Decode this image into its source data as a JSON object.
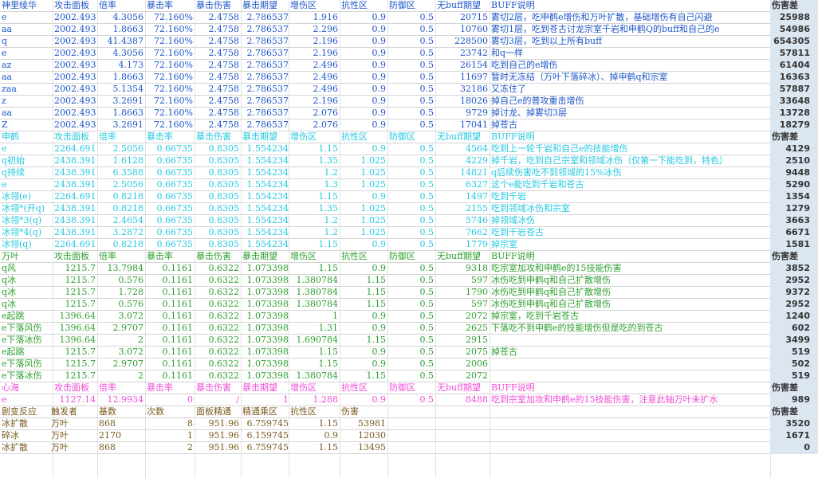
{
  "colors": {
    "ayaka": "#1e56c8",
    "shenhe": "#26c8e0",
    "kazuha": "#2e9e2e",
    "kokomi": "#f04cd6",
    "reaction": "#7a5a1e",
    "damage_bg": "#dce6f1"
  },
  "ayaka": {
    "header": [
      "神里绫华",
      "攻击面板",
      "倍率",
      "暴击率",
      "暴击伤害",
      "暴击期望",
      "增伤区",
      "抗性区",
      "防御区",
      "无buff期望",
      "BUFF说明",
      "伤害差"
    ],
    "rows": [
      [
        "e",
        "2002.493",
        "4.3056",
        "72.160%",
        "2.4758",
        "2.786537",
        "1.916",
        "0.9",
        "0.5",
        "20715",
        "雾切2层，吃申鹤e增伤和万叶扩散，基础增伤有自己闪避",
        "25988"
      ],
      [
        "aa",
        "2002.493",
        "1.8663",
        "72.160%",
        "2.4758",
        "2.786537",
        "2.296",
        "0.9",
        "0.5",
        "10760",
        "雾切1层，吃到苍古讨龙宗室千岩和申鹤Q的buff和自己的e",
        "54986"
      ],
      [
        "q",
        "2002.493",
        "41.4387",
        "72.160%",
        "2.4758",
        "2.786537",
        "2.196",
        "0.9",
        "0.5",
        "228500",
        "雾切3层，吃到以上所有buff",
        "654305"
      ],
      [
        "e",
        "2002.493",
        "4.3056",
        "72.160%",
        "2.4758",
        "2.786537",
        "2.196",
        "0.9",
        "0.5",
        "23742",
        "和q一样",
        "57811"
      ],
      [
        "az",
        "2002.493",
        "4.173",
        "72.160%",
        "2.4758",
        "2.786537",
        "2.496",
        "0.9",
        "0.5",
        "26154",
        "吃到自己的e增伤",
        "61404"
      ],
      [
        "aa",
        "2002.493",
        "1.8663",
        "72.160%",
        "2.4758",
        "2.786537",
        "2.496",
        "0.9",
        "0.5",
        "11697",
        "暂时无冻结（万叶下落碎冰）、掉申鹤q和宗室",
        "16363"
      ],
      [
        "zaa",
        "2002.493",
        "5.1354",
        "72.160%",
        "2.4758",
        "2.786537",
        "2.496",
        "0.9",
        "0.5",
        "32186",
        "又冻住了",
        "57887"
      ],
      [
        "z",
        "2002.493",
        "3.2691",
        "72.160%",
        "2.4758",
        "2.786537",
        "2.196",
        "0.9",
        "0.5",
        "18026",
        "掉自己e的普攻重击增伤",
        "33648"
      ],
      [
        "aa",
        "2002.493",
        "1.8663",
        "72.160%",
        "2.4758",
        "2.786537",
        "2.076",
        "0.9",
        "0.5",
        "9729",
        "掉讨龙、掉雾切3层",
        "13728"
      ],
      [
        "Z",
        "2002.493",
        "3.2691",
        "72.160%",
        "2.4758",
        "2.786537",
        "2.076",
        "0.9",
        "0.5",
        "17041",
        "掉苍古",
        "18279"
      ]
    ]
  },
  "shenhe": {
    "header": [
      "申鹤",
      "攻击面板",
      "倍率",
      "暴击率",
      "暴击伤害",
      "暴击期望",
      "增伤区",
      "抗性区",
      "防御区",
      "无buff期望",
      "BUFF说明",
      "伤害差"
    ],
    "rows": [
      [
        "e",
        "2264.691",
        "2.5056",
        "0.66735",
        "0.8305",
        "1.554234",
        "1.15",
        "0.9",
        "0.5",
        "4564",
        "吃到上一轮千岩和自己e的技能增伤",
        "4129"
      ],
      [
        "q初始",
        "2438.391",
        "1.6128",
        "0.66735",
        "0.8305",
        "1.554234",
        "1.35",
        "1.025",
        "0.5",
        "4229",
        "掉千岩，吃到自己宗室和领域冰伤（仅第一下能吃到，特色）",
        "2510"
      ],
      [
        "q持续",
        "2438.391",
        "6.3588",
        "0.66735",
        "0.8305",
        "1.554234",
        "1.2",
        "1.025",
        "0.5",
        "14821",
        "q后续伤害吃不到领域的15%冰伤",
        "9448"
      ],
      [
        "e",
        "2438.391",
        "2.5056",
        "0.66735",
        "0.8305",
        "1.554234",
        "1.3",
        "1.025",
        "0.5",
        "6327",
        "这个e能吃到千岩和苍古",
        "5290"
      ],
      [
        "冰翎(e)",
        "2264.691",
        "0.8218",
        "0.66735",
        "0.8305",
        "1.554234",
        "1.15",
        "0.9",
        "0.5",
        "1497",
        "吃到千岩",
        "1354"
      ],
      [
        "冰翎*(开q)",
        "2438.391",
        "0.8218",
        "0.66735",
        "0.8305",
        "1.554234",
        "1.35",
        "1.025",
        "0.5",
        "2155",
        "吃到领域冰伤和宗室",
        "1279"
      ],
      [
        "冰翎*3(q)",
        "2438.391",
        "2.4654",
        "0.66735",
        "0.8305",
        "1.554234",
        "1.2",
        "1.025",
        "0.5",
        "5746",
        "掉领域冰伤",
        "3663"
      ],
      [
        "冰翎*4(q)",
        "2438.391",
        "3.2872",
        "0.66735",
        "0.8305",
        "1.554234",
        "1.2",
        "1.025",
        "0.5",
        "7662",
        "吃到千岩苍古",
        "6671"
      ],
      [
        "冰翎(q)",
        "2264.691",
        "0.8218",
        "0.66735",
        "0.8305",
        "1.554234",
        "1.15",
        "0.9",
        "0.5",
        "1779",
        "掉宗室",
        "1581"
      ]
    ]
  },
  "kazuha": {
    "header": [
      "万叶",
      "攻击面板",
      "倍率",
      "暴击率",
      "暴击伤害",
      "暴击期望",
      "增伤区",
      "抗性区",
      "防御区",
      "无buff期望",
      "BUFF说明",
      "伤害差"
    ],
    "rows": [
      [
        "q风",
        "1215.7",
        "13.7984",
        "0.1161",
        "0.6322",
        "1.073398",
        "1.15",
        "0.9",
        "0.5",
        "9318",
        "吃宗室加攻和申鹤e的15技能伤害",
        "3852"
      ],
      [
        "q冰",
        "1215.7",
        "0.576",
        "0.1161",
        "0.6322",
        "1.073398",
        "1.380784",
        "1.15",
        "0.5",
        "597",
        "冰伤吃到申鹤q和自己扩散增伤",
        "2952"
      ],
      [
        "q冰",
        "1215.7",
        "1.728",
        "0.1161",
        "0.6322",
        "1.073398",
        "1.380784",
        "1.15",
        "0.5",
        "1790",
        "冰伤吃到申鹤q和自己扩散增伤",
        "9372"
      ],
      [
        "q冰",
        "1215.7",
        "0.576",
        "0.1161",
        "0.6322",
        "1.073398",
        "1.380784",
        "1.15",
        "0.5",
        "597",
        "冰伤吃到申鹤q和自己扩散增伤",
        "2952"
      ],
      [
        "e起跳",
        "1396.64",
        "3.072",
        "0.1161",
        "0.6322",
        "1.073398",
        "1",
        "0.9",
        "0.5",
        "2072",
        "掉宗室，吃到千岩苍古",
        "1240"
      ],
      [
        "e下落风伤",
        "1396.64",
        "2.9707",
        "0.1161",
        "0.6322",
        "1.073398",
        "1.31",
        "0.9",
        "0.5",
        "2625",
        "下落吃不到申鹤e的技能增伤但是吃的到苍古",
        "602"
      ],
      [
        "e下落冰伤",
        "1396.64",
        "2",
        "0.1161",
        "0.6322",
        "1.073398",
        "1.690784",
        "1.15",
        "0.5",
        "2915",
        "",
        "3499"
      ],
      [
        "e起跳",
        "1215.7",
        "3.072",
        "0.1161",
        "0.6322",
        "1.073398",
        "1.15",
        "0.9",
        "0.5",
        "2075",
        "掉苍古",
        "519"
      ],
      [
        "e下落风伤",
        "1215.7",
        "2.9707",
        "0.1161",
        "0.6322",
        "1.073398",
        "1.15",
        "0.9",
        "0.5",
        "2006",
        "",
        "502"
      ],
      [
        "e下落冰伤",
        "1215.7",
        "2",
        "0.1161",
        "0.6322",
        "1.073398",
        "1.380784",
        "1.15",
        "0.5",
        "2072",
        "",
        "519"
      ]
    ]
  },
  "kokomi": {
    "header": [
      "心海",
      "攻击面板",
      "倍率",
      "暴击率",
      "暴击伤害",
      "暴击期望",
      "增伤区",
      "抗性区",
      "防御区",
      "无buff期望",
      "BUFF说明",
      "伤害差"
    ],
    "rows": [
      [
        "e",
        "1127.14",
        "12.9934",
        "0",
        "/",
        "1",
        "1.288",
        "0.9",
        "0.5",
        "8488",
        "吃到宗室加攻和申鹤e的15技能伤害，注意此轴万叶未扩水",
        "989"
      ]
    ]
  },
  "reactions": {
    "header": [
      "剧变反应",
      "触发者",
      "基数",
      "次数",
      "面板精通",
      "精通乘区",
      "抗性区",
      "伤害",
      "伤害差"
    ],
    "rows": [
      [
        "冰扩散",
        "万叶",
        "868",
        "8",
        "951.96",
        "6.759745",
        "1.15",
        "53981",
        "3520"
      ],
      [
        "碎冰",
        "万叶",
        "2170",
        "1",
        "951.96",
        "6.159745",
        "0.9",
        "12030",
        "1671"
      ],
      [
        "冰扩散",
        "万叶",
        "868",
        "2",
        "951.96",
        "6.759745",
        "1.15",
        "13495",
        "0"
      ]
    ]
  }
}
